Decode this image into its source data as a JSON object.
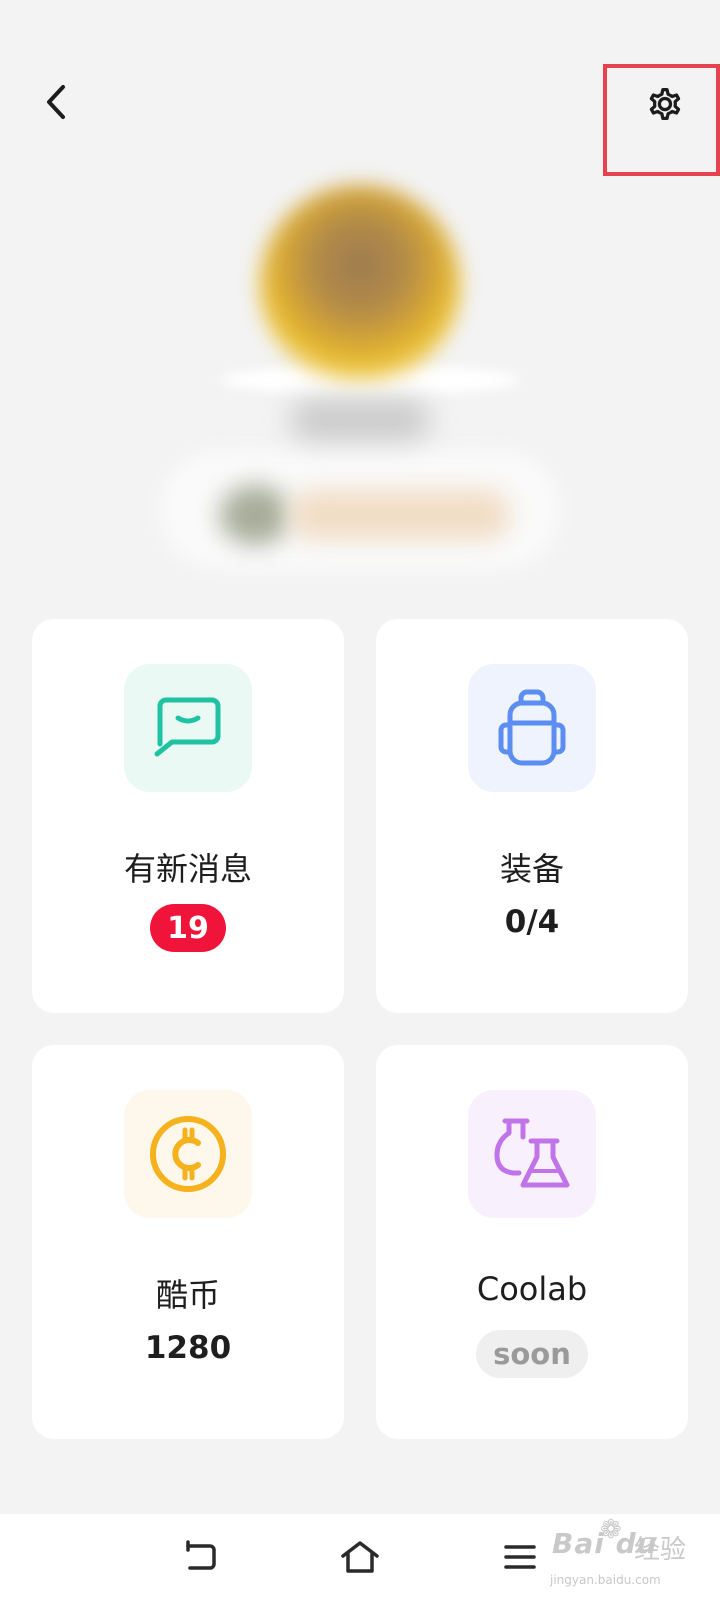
{
  "header": {
    "back_icon": "chevron-left-icon",
    "settings_icon": "gear-icon",
    "highlight_color": "#e5434f"
  },
  "cards": [
    {
      "title": "有新消息",
      "badge": "19",
      "icon": "chat-bubble-icon",
      "icon_color": "#1fc3a1",
      "tile_bg": "#ebf9f5",
      "badge_color": "#f0143a"
    },
    {
      "title": "装备",
      "value": "0/4",
      "icon": "backpack-icon",
      "icon_color": "#5b8ef0",
      "tile_bg": "#eef3fd"
    },
    {
      "title": "酷币",
      "value": "1280",
      "icon": "coin-icon",
      "icon_color": "#f6b21c",
      "tile_bg": "#fef7eb"
    },
    {
      "title": "Coolab",
      "status": "soon",
      "icon": "flask-icon",
      "icon_color": "#c074e8",
      "tile_bg": "#f8f0fd"
    }
  ],
  "nav": {
    "back_icon": "nav-back-icon",
    "home_icon": "home-icon",
    "menu_icon": "menu-icon"
  },
  "watermark": {
    "logo": "Bai du",
    "cn": "经验",
    "url": "jingyan.baidu.com"
  }
}
